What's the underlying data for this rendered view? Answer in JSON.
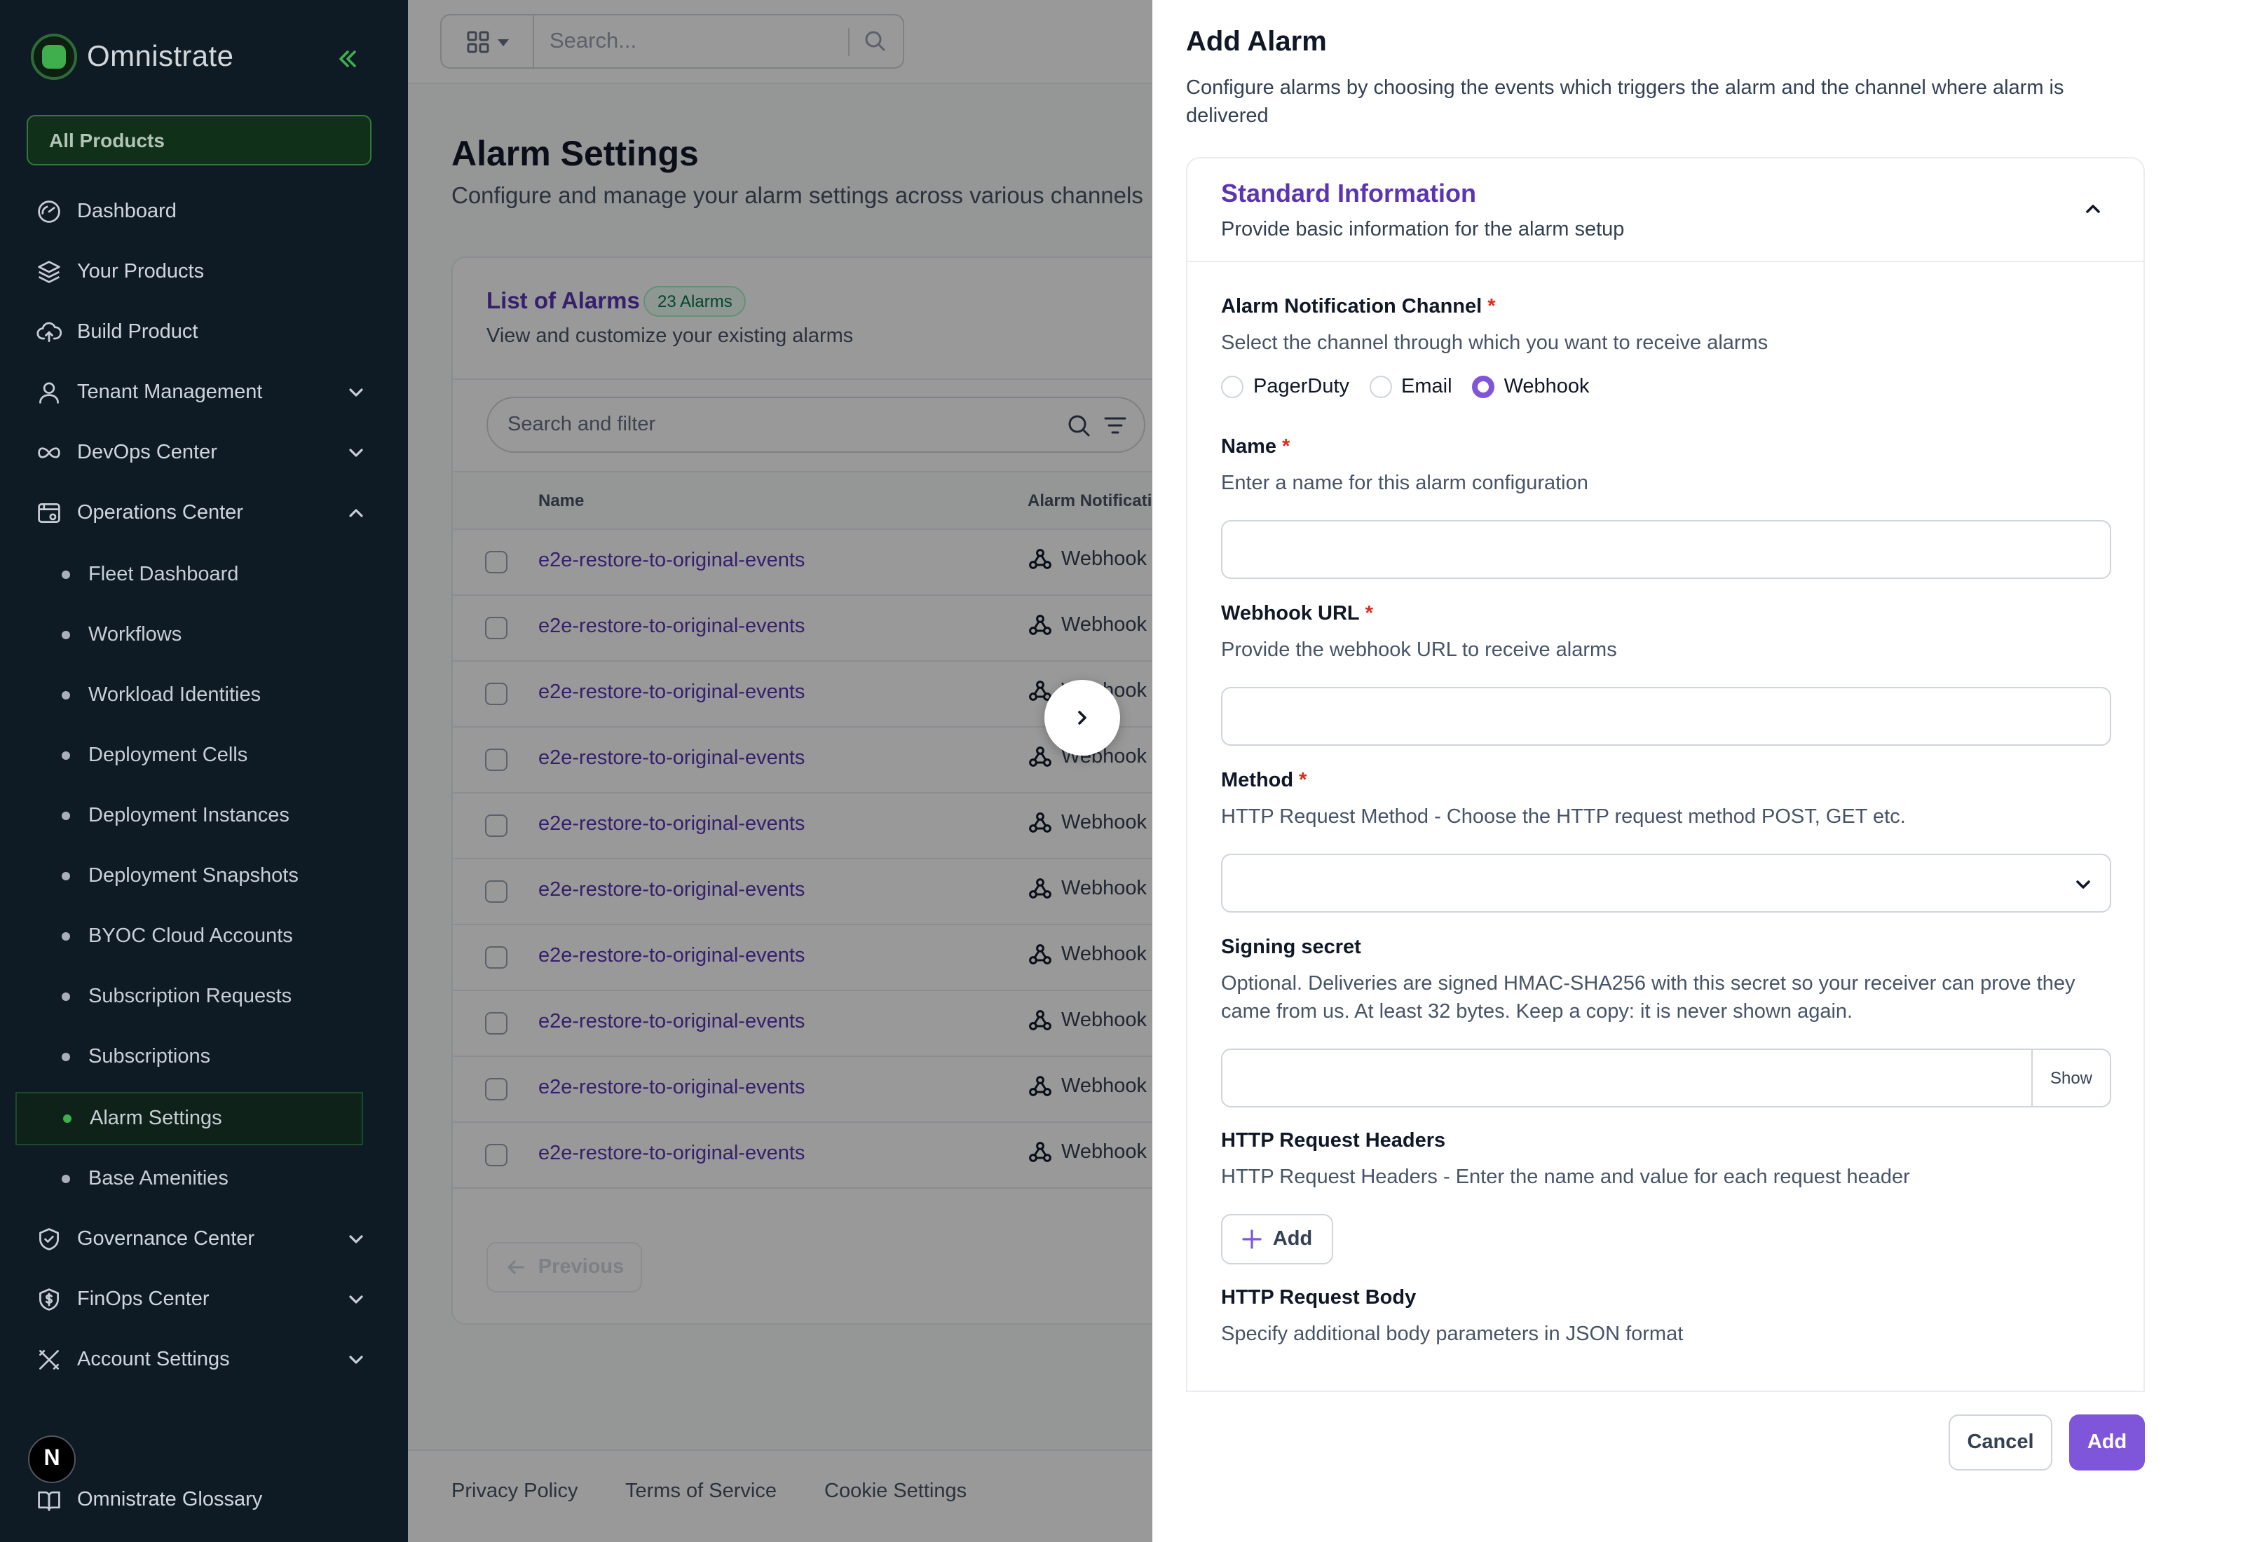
{
  "sidebar": {
    "logo_text": "Omnistrate",
    "all_products": "All Products",
    "items": [
      {
        "label": "Dashboard",
        "icon": "gauge-icon"
      },
      {
        "label": "Your Products",
        "icon": "layers-icon"
      },
      {
        "label": "Build Product",
        "icon": "cloud-upload-icon"
      },
      {
        "label": "Tenant Management",
        "icon": "user-icon",
        "expandable": true
      },
      {
        "label": "DevOps Center",
        "icon": "infinity-icon",
        "expandable": true
      },
      {
        "label": "Operations Center",
        "icon": "calendar-settings-icon",
        "expanded": true
      }
    ],
    "sub_items": [
      "Fleet Dashboard",
      "Workflows",
      "Workload Identities",
      "Deployment Cells",
      "Deployment Instances",
      "Deployment Snapshots",
      "BYOC Cloud Accounts",
      "Subscription Requests",
      "Subscriptions",
      "Alarm Settings",
      "Base Amenities"
    ],
    "active_sub_item": "Alarm Settings",
    "bottom_items": [
      {
        "label": "Governance Center",
        "icon": "shield-check-icon"
      },
      {
        "label": "FinOps Center",
        "icon": "dollar-shield-icon"
      },
      {
        "label": "Account Settings",
        "icon": "tools-icon"
      }
    ],
    "avatar_letter": "N",
    "glossary": "Omnistrate Glossary"
  },
  "topbar": {
    "search_placeholder": "Search..."
  },
  "page": {
    "title": "Alarm Settings",
    "subtitle": "Configure and manage your alarm settings across various channels"
  },
  "alarms_card": {
    "title": "List of Alarms",
    "badge": "23 Alarms",
    "subtitle": "View and customize your existing alarms",
    "search_placeholder": "Search and filter",
    "columns": [
      "Name",
      "Alarm Notification Channel"
    ],
    "rows": [
      {
        "name": "e2e-restore-to-original-events",
        "channel": "Webhook"
      },
      {
        "name": "e2e-restore-to-original-events",
        "channel": "Webhook"
      },
      {
        "name": "e2e-restore-to-original-events",
        "channel": "Webhook"
      },
      {
        "name": "e2e-restore-to-original-events",
        "channel": "Webhook"
      },
      {
        "name": "e2e-restore-to-original-events",
        "channel": "Webhook"
      },
      {
        "name": "e2e-restore-to-original-events",
        "channel": "Webhook"
      },
      {
        "name": "e2e-restore-to-original-events",
        "channel": "Webhook"
      },
      {
        "name": "e2e-restore-to-original-events",
        "channel": "Webhook"
      },
      {
        "name": "e2e-restore-to-original-events",
        "channel": "Webhook"
      },
      {
        "name": "e2e-restore-to-original-events",
        "channel": "Webhook"
      }
    ],
    "previous_label": "Previous"
  },
  "footer": {
    "links": [
      "Privacy Policy",
      "Terms of Service",
      "Cookie Settings"
    ]
  },
  "drawer": {
    "title": "Add Alarm",
    "subtitle": "Configure alarms by choosing the events which triggers the alarm and the channel where alarm is delivered",
    "section": {
      "title": "Standard Information",
      "subtitle": "Provide basic information for the alarm setup"
    },
    "channel": {
      "label": "Alarm Notification Channel",
      "help": "Select the channel through which you want to receive alarms",
      "options": [
        "PagerDuty",
        "Email",
        "Webhook"
      ],
      "selected": "Webhook"
    },
    "name": {
      "label": "Name",
      "help": "Enter a name for this alarm configuration",
      "value": ""
    },
    "webhook_url": {
      "label": "Webhook URL",
      "help": "Provide the webhook URL to receive alarms",
      "value": ""
    },
    "method": {
      "label": "Method",
      "help": "HTTP Request Method - Choose the HTTP request method POST, GET etc.",
      "value": ""
    },
    "signing_secret": {
      "label": "Signing secret",
      "help": "Optional. Deliveries are signed HMAC-SHA256 with this secret so your receiver can prove they came from us. At least 32 bytes. Keep a copy: it is never shown again.",
      "show_label": "Show",
      "value": ""
    },
    "headers": {
      "label": "HTTP Request Headers",
      "help": "HTTP Request Headers - Enter the name and value for each request header",
      "add_label": "Add"
    },
    "body": {
      "label": "HTTP Request Body",
      "help": "Specify additional body parameters in JSON format"
    },
    "required_mark": "*",
    "cancel_label": "Cancel",
    "add_label": "Add"
  },
  "colors": {
    "sidebar_bg": "#0e1b25",
    "brand_green": "#3fae4d",
    "accent_purple": "#7f56d9",
    "link_purple": "#5b34b4",
    "required_red": "#d92d20"
  }
}
